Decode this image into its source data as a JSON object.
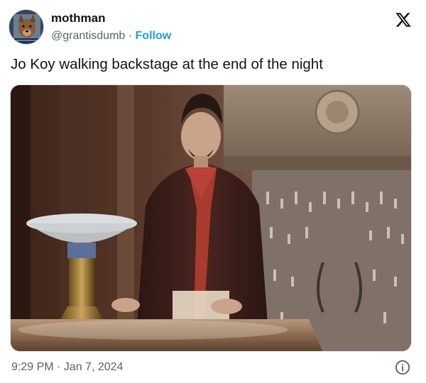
{
  "author": {
    "display_name": "mothman",
    "handle": "@grantisdumb",
    "separator": "·",
    "follow_label": "Follow",
    "avatar_icon": "dog-avatar-icon"
  },
  "brand": {
    "logo_icon": "x-logo-icon",
    "color": "#0f1419"
  },
  "tweet": {
    "text": "Jo Koy walking backstage at the end of the night",
    "timestamp": "9:29 PM · Jan 7, 2024"
  },
  "media": {
    "description_icon": "photo-man-in-suit-with-chalice"
  },
  "colors": {
    "text": "#0f1419",
    "secondary": "#536471",
    "accent": "#1d9bf0"
  },
  "footer": {
    "info_icon": "info-icon"
  }
}
